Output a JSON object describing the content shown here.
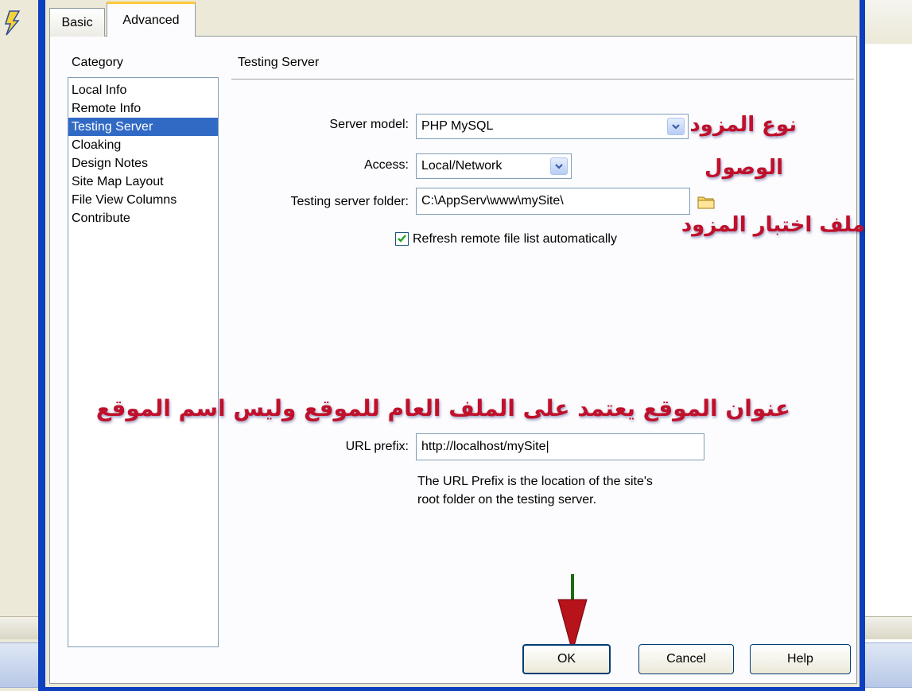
{
  "tabs": {
    "basic": "Basic",
    "advanced": "Advanced"
  },
  "category": {
    "header": "Category",
    "items": [
      "Local Info",
      "Remote Info",
      "Testing Server",
      "Cloaking",
      "Design Notes",
      "Site Map Layout",
      "File View Columns",
      "Contribute"
    ],
    "selected": "Testing Server"
  },
  "section_title": "Testing Server",
  "form": {
    "server_model_label": "Server model:",
    "server_model_value": "PHP MySQL",
    "access_label": "Access:",
    "access_value": "Local/Network",
    "folder_label": "Testing server folder:",
    "folder_value": "C:\\AppServ\\www\\mySite\\",
    "refresh_label": "Refresh remote file list automatically",
    "refresh_checked": true,
    "url_prefix_label": "URL prefix:",
    "url_prefix_value": "http://localhost/mySite|",
    "url_help_line1": "The URL Prefix is the location of the site's",
    "url_help_line2": "root folder on the testing server."
  },
  "annotations": {
    "server_type": "نوع المزود",
    "access": "الوصول",
    "testing_folder": "ملف اختبار المزود",
    "url_note": "عنوان الموقع يعتمد على الملف العام للموقع وليس اسم الموقع"
  },
  "buttons": {
    "ok": "OK",
    "cancel": "Cancel",
    "help": "Help"
  },
  "icons": {
    "app": "lightning-icon",
    "folder": "folder-icon",
    "dropdown": "chevron-down-icon",
    "checkbox": "checkmark-icon",
    "arrow": "arrow-down-icon"
  },
  "colors": {
    "selection": "#316ac5",
    "annotation": "#c0102a",
    "dialog_frame": "#0b3fbe",
    "tab_accent": "#ffc73c"
  }
}
